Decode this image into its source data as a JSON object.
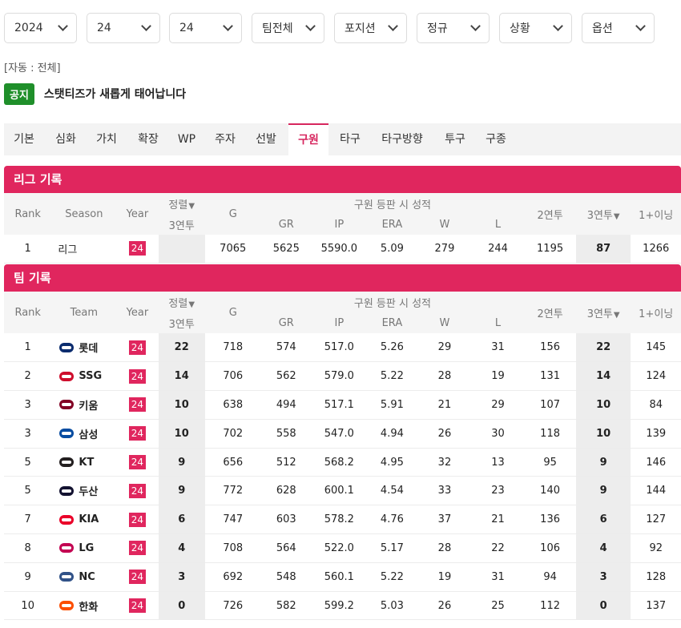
{
  "filters": [
    {
      "value": "2024"
    },
    {
      "value": "24"
    },
    {
      "value": "24"
    },
    {
      "value": "팀전체"
    },
    {
      "value": "포지션"
    },
    {
      "value": "정규"
    },
    {
      "value": "상황"
    },
    {
      "value": "옵션"
    }
  ],
  "auto_label": "[자동 : 전체]",
  "notice": {
    "badge": "공지",
    "text": "스탯티즈가 새롭게 태어납니다"
  },
  "tabs": [
    "기본",
    "심화",
    "가치",
    "확장",
    "WP",
    "주자",
    "선발",
    "구원",
    "타구",
    "타구방향",
    "투구",
    "구종"
  ],
  "active_tab": "구원",
  "league": {
    "title": "리그 기록",
    "headers": {
      "rank": "Rank",
      "season": "Season",
      "year": "Year",
      "sort": "정렬",
      "sort_sub": "3연투",
      "g": "G",
      "group": "구원 등판 시 성적",
      "gr": "GR",
      "ip": "IP",
      "era": "ERA",
      "w": "W",
      "l": "L",
      "two": "2연투",
      "three": "3연투",
      "one_plus": "1+이닝"
    },
    "row": {
      "rank": "1",
      "season": "리그",
      "year": "24",
      "g": "7065",
      "gr": "5625",
      "ip": "5590.0",
      "era": "5.09",
      "w": "279",
      "l": "244",
      "two": "1195",
      "three": "87",
      "one_plus": "1266"
    }
  },
  "team": {
    "title": "팀 기록",
    "headers": {
      "rank": "Rank",
      "team": "Team",
      "year": "Year",
      "sort": "정렬",
      "sort_sub": "3연투",
      "g": "G",
      "group": "구원 등판 시 성적",
      "gr": "GR",
      "ip": "IP",
      "era": "ERA",
      "w": "W",
      "l": "L",
      "two": "2연투",
      "three": "3연투",
      "one_plus": "1+이닝"
    },
    "rows": [
      {
        "rank": "1",
        "team": "롯데",
        "logo": "#0b2c6e",
        "year": "24",
        "sort": "22",
        "g": "718",
        "gr": "574",
        "ip": "517.0",
        "era": "5.26",
        "w": "29",
        "l": "31",
        "two": "156",
        "three": "22",
        "one_plus": "145"
      },
      {
        "rank": "2",
        "team": "SSG",
        "logo": "#ce0e2d",
        "year": "24",
        "sort": "14",
        "g": "706",
        "gr": "562",
        "ip": "579.0",
        "era": "5.22",
        "w": "28",
        "l": "19",
        "two": "131",
        "three": "14",
        "one_plus": "124"
      },
      {
        "rank": "3",
        "team": "키움",
        "logo": "#820024",
        "year": "24",
        "sort": "10",
        "g": "638",
        "gr": "494",
        "ip": "517.1",
        "era": "5.91",
        "w": "21",
        "l": "29",
        "two": "107",
        "three": "10",
        "one_plus": "84"
      },
      {
        "rank": "3",
        "team": "삼성",
        "logo": "#074ca1",
        "year": "24",
        "sort": "10",
        "g": "702",
        "gr": "558",
        "ip": "547.0",
        "era": "4.94",
        "w": "26",
        "l": "30",
        "two": "118",
        "three": "10",
        "one_plus": "139"
      },
      {
        "rank": "5",
        "team": "KT",
        "logo": "#231f20",
        "year": "24",
        "sort": "9",
        "g": "656",
        "gr": "512",
        "ip": "568.2",
        "era": "4.95",
        "w": "32",
        "l": "13",
        "two": "95",
        "three": "9",
        "one_plus": "146"
      },
      {
        "rank": "5",
        "team": "두산",
        "logo": "#131230",
        "year": "24",
        "sort": "9",
        "g": "772",
        "gr": "628",
        "ip": "600.1",
        "era": "4.54",
        "w": "33",
        "l": "23",
        "two": "140",
        "three": "9",
        "one_plus": "144"
      },
      {
        "rank": "7",
        "team": "KIA",
        "logo": "#ea0029",
        "year": "24",
        "sort": "6",
        "g": "747",
        "gr": "603",
        "ip": "578.2",
        "era": "4.76",
        "w": "37",
        "l": "21",
        "two": "136",
        "three": "6",
        "one_plus": "127"
      },
      {
        "rank": "8",
        "team": "LG",
        "logo": "#c30452",
        "year": "24",
        "sort": "4",
        "g": "708",
        "gr": "564",
        "ip": "522.0",
        "era": "5.17",
        "w": "28",
        "l": "22",
        "two": "106",
        "three": "4",
        "one_plus": "92"
      },
      {
        "rank": "9",
        "team": "NC",
        "logo": "#315288",
        "year": "24",
        "sort": "3",
        "g": "692",
        "gr": "548",
        "ip": "560.1",
        "era": "5.22",
        "w": "19",
        "l": "31",
        "two": "94",
        "three": "3",
        "one_plus": "128"
      },
      {
        "rank": "10",
        "team": "한화",
        "logo": "#fc4e00",
        "year": "24",
        "sort": "0",
        "g": "726",
        "gr": "582",
        "ip": "599.2",
        "era": "5.03",
        "w": "26",
        "l": "25",
        "two": "112",
        "three": "0",
        "one_plus": "137"
      }
    ]
  },
  "colors": {
    "accent": "#e0265e",
    "notice_green": "#1f8f2a",
    "highlight_col": "#ededed"
  }
}
